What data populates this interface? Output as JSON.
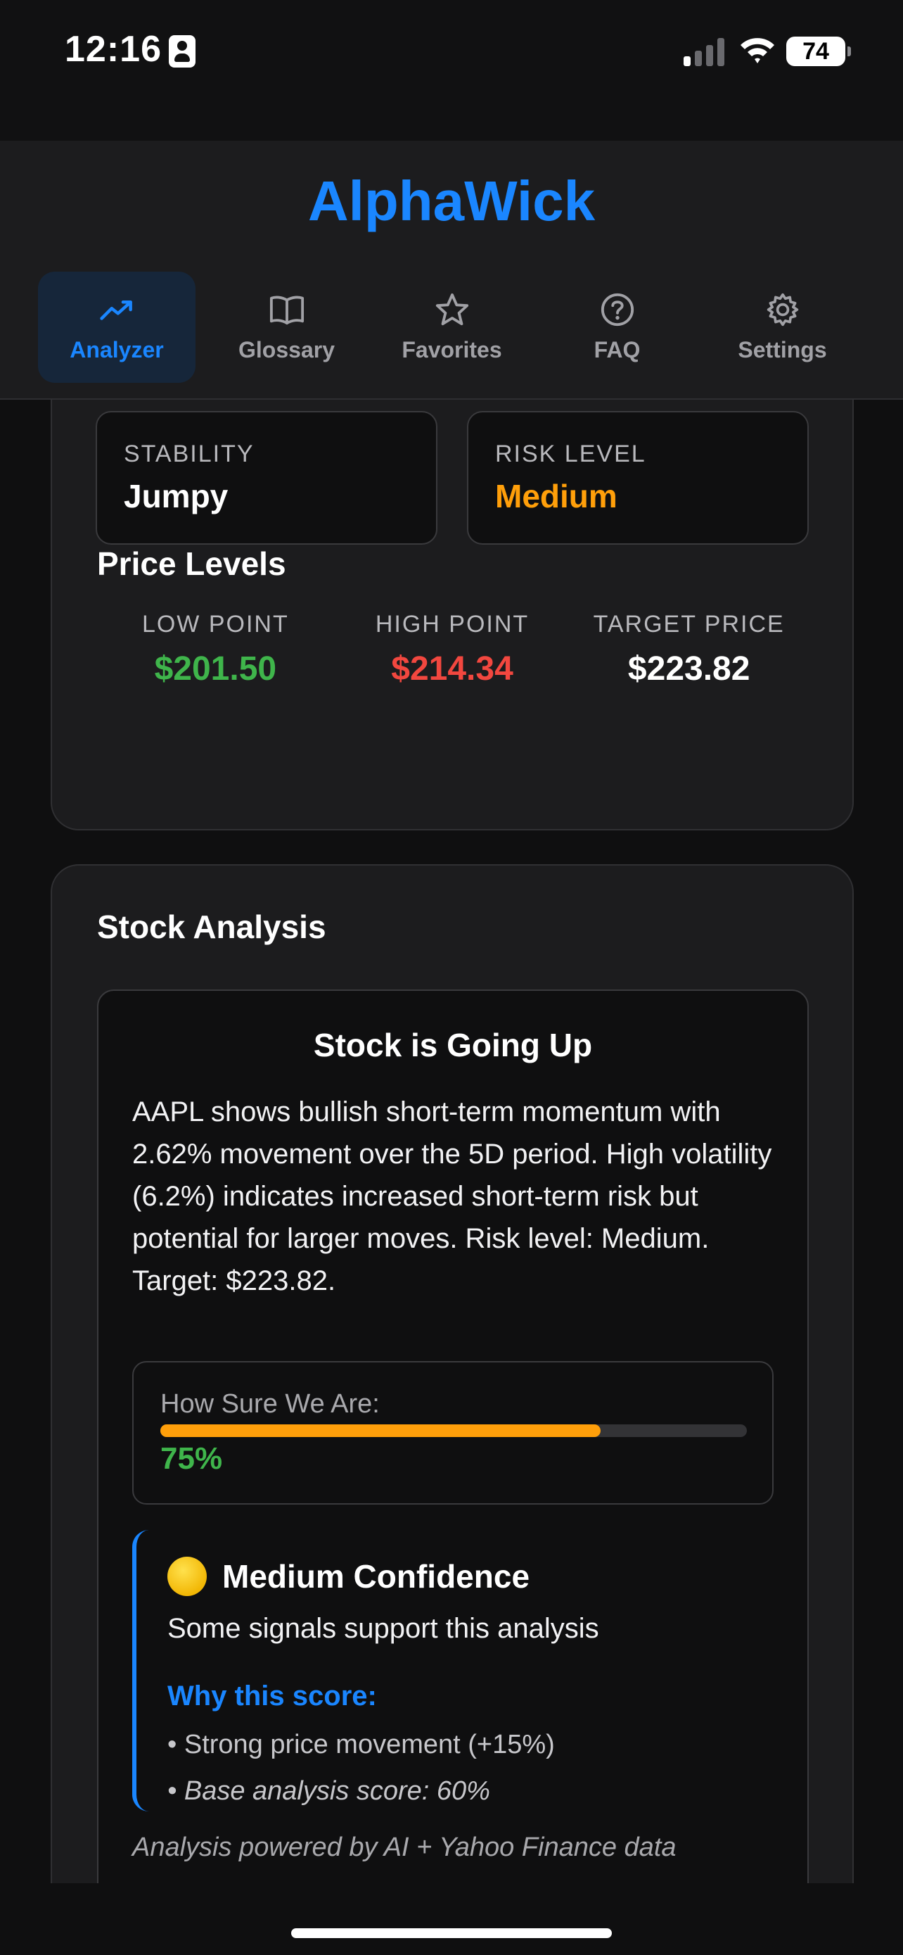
{
  "status_bar": {
    "time": "12:16",
    "battery": "74"
  },
  "app": {
    "title": "AlphaWick"
  },
  "tabs": [
    {
      "label": "Analyzer",
      "icon": "trend-up-icon",
      "active": true
    },
    {
      "label": "Glossary",
      "icon": "book-icon"
    },
    {
      "label": "Favorites",
      "icon": "star-icon"
    },
    {
      "label": "FAQ",
      "icon": "question-circle-icon"
    },
    {
      "label": "Settings",
      "icon": "gear-icon"
    }
  ],
  "metrics": {
    "stability": {
      "label": "STABILITY",
      "value": "Jumpy"
    },
    "risk": {
      "label": "RISK LEVEL",
      "value": "Medium"
    }
  },
  "price_levels": {
    "title": "Price Levels",
    "low": {
      "label": "LOW POINT",
      "value": "$201.50"
    },
    "high": {
      "label": "HIGH POINT",
      "value": "$214.34"
    },
    "target": {
      "label": "TARGET PRICE",
      "value": "$223.82"
    }
  },
  "analysis": {
    "section_title": "Stock Analysis",
    "headline": "Stock is Going Up",
    "summary": "AAPL shows bullish short-term momentum with 2.62% movement over the 5D period. High volatility (6.2%) indicates increased short-term risk but potential for larger moves. Risk level: Medium. Target: $223.82.",
    "confidence_label": "How Sure We Are:",
    "confidence_value": "75%",
    "confidence_fraction": 0.75,
    "confidence_title": "Medium Confidence",
    "confidence_subtitle": "Some signals support this analysis",
    "why_title": "Why this score:",
    "reasons": [
      "• Strong price movement (+15%)",
      "• Base analysis score: 60%"
    ],
    "powered_by": "Analysis powered by AI + Yahoo Finance data"
  },
  "colors": {
    "accent": "#1a86ff",
    "orange": "#ff9f0a",
    "green": "#3fb54b",
    "red": "#f2473f"
  }
}
